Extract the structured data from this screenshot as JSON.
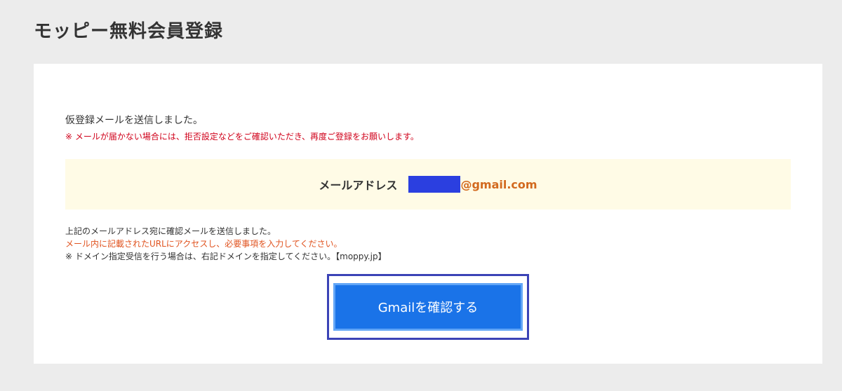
{
  "header": {
    "title": "モッピー無料会員登録"
  },
  "main": {
    "sent_message": "仮登録メールを送信しました。",
    "warning": "※ メールが届かない場合には、拒否設定などをご確認いただき、再度ご登録をお願いします。",
    "email": {
      "label": "メールアドレス",
      "domain": "@gmail.com",
      "redaction_color": "#2b3fe0"
    },
    "notes": [
      "上記のメールアドレス宛に確認メールを送信しました。",
      "メール内に記載されたURLにアクセスし、必要事項を入力してください。",
      "※ ドメイン指定受信を行う場合は、右記ドメインを指定してください。【moppy.jp】"
    ],
    "gmail_button_label": "Gmailを確認する"
  },
  "colors": {
    "background": "#ececec",
    "card": "#ffffff",
    "warning": "#d0021b",
    "accent_orange": "#d2691e",
    "button": "#1a73e8",
    "highlight_box": "#fffbe6"
  }
}
